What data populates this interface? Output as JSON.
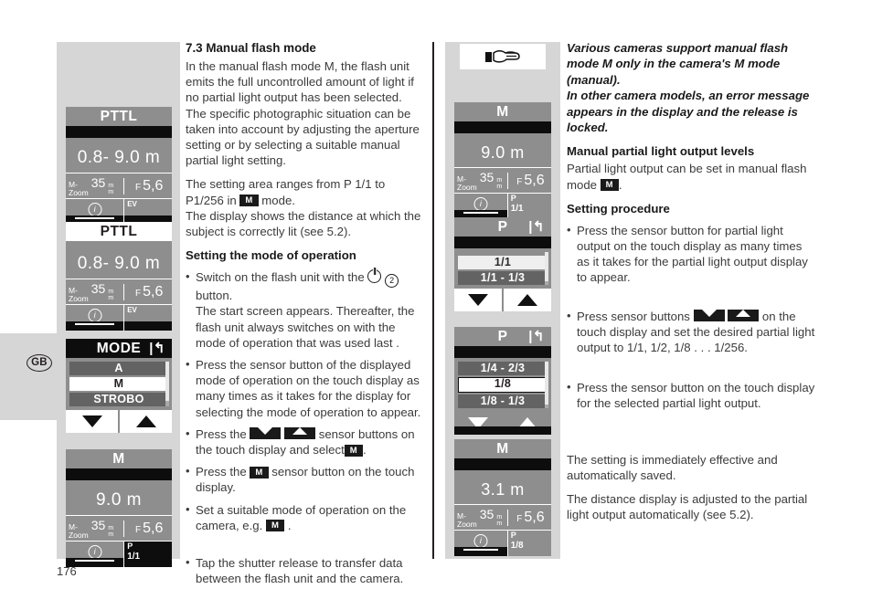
{
  "page": {
    "number": "176",
    "language_badge": "GB"
  },
  "left_column": {
    "panels": [
      {
        "name": "pttl-start-screen",
        "title": "PTTL",
        "title_style": "grey",
        "distance": "0.8- 9.0 m",
        "zoom_label_line1": "M-",
        "zoom_label_line2": "Zoom",
        "zoom_value": "35",
        "unit_line1": "m",
        "unit_line2": "m",
        "f_char": "F",
        "f_value": "5,6",
        "right_label": "EV",
        "info_icon": "info-icon"
      },
      {
        "name": "pttl-selected-screen",
        "title": "PTTL",
        "title_style": "white",
        "distance": "0.8- 9.0 m",
        "zoom_label_line1": "M-",
        "zoom_label_line2": "Zoom",
        "zoom_value": "35",
        "unit_line1": "m",
        "unit_line2": "m",
        "f_char": "F",
        "f_value": "5,6",
        "right_label": "EV",
        "info_icon": "info-icon"
      },
      {
        "name": "mode-picker",
        "title": "MODE",
        "back_icon": "back-arrow-icon",
        "items": [
          {
            "label": "A",
            "state": "dim"
          },
          {
            "label": "M",
            "state": "selected"
          },
          {
            "label": "STROBO",
            "state": "dim"
          }
        ],
        "arrow_down": "down-arrow-icon",
        "arrow_up": "up-arrow-icon"
      },
      {
        "name": "m-mode-screen",
        "title": "M",
        "title_style": "grey",
        "distance": "9.0 m",
        "zoom_label_line1": "M-",
        "zoom_label_line2": "Zoom",
        "zoom_value": "35",
        "unit_line1": "m",
        "unit_line2": "m",
        "f_char": "F",
        "f_value": "5,6",
        "right_label": "P",
        "right_value": "1/1",
        "info_icon": "info-icon"
      }
    ]
  },
  "mid_column": {
    "heading": "7.3 Manual flash mode",
    "para1": "In the manual flash mode M, the flash unit emits the full uncontrolled amount of light if no partial light output has been selected. The specific photographic situation can be taken into account by adjusting the aperture setting or by selecting a suitable manual partial light setting.",
    "para2_a": "The setting area ranges from P 1/1 to P1/256 in",
    "para2_badge": "M",
    "para2_b": "mode.",
    "para3": "The display shows the distance at which the subject is correctly lit (see 5.2).",
    "subheading": "Setting the mode of operation",
    "bullets": [
      {
        "text_a": "Switch on the flash unit with the",
        "icon": "power-icon",
        "circle_num": "2",
        "text_b": "button.",
        "sub": "The start screen appears. Thereafter, the flash unit always switches on with the mode of operation that was used last ."
      },
      {
        "text_a": "Press the sensor button of the displayed mode of operation on the touch display as many times as it takes for the display for selecting the mode of operation to appear."
      },
      {
        "text_a": "Press the",
        "badge_down": "down-arrow-badge",
        "badge_up": "up-arrow-badge",
        "text_b": "sensor buttons on the touch display and select",
        "badge_m": "M",
        "text_c": "."
      },
      {
        "text_a": "Press the",
        "badge_m": "M",
        "text_b": "sensor button on the touch display."
      },
      {
        "text_a": "Set a suitable mode of operation on the camera, e.g.",
        "badge_m": "M",
        "text_b": "."
      },
      {
        "text_a": "Tap the shutter release to transfer data between the flash unit and the camera."
      }
    ]
  },
  "right_illustration": {
    "hand_icon": "pointing-hand-icon",
    "panels": [
      {
        "name": "m-mode-screen-full",
        "title": "M",
        "distance": "9.0 m",
        "zoom_label_line1": "M-",
        "zoom_label_line2": "Zoom",
        "zoom_value": "35",
        "unit_line1": "m",
        "unit_line2": "m",
        "f_char": "F",
        "f_value": "5,6",
        "right_label": "P",
        "right_value": "1/1",
        "info_icon": "info-icon"
      },
      {
        "name": "partial-output-picker-1",
        "title": "P",
        "back_icon": "back-arrow-icon",
        "items": [
          {
            "label": "",
            "state": "blank"
          },
          {
            "label": "1/1",
            "state": "pale"
          },
          {
            "label": "1/1 - 1/3",
            "state": "dim"
          }
        ],
        "arrow_down": "down-arrow-icon",
        "arrow_up": "up-arrow-icon"
      },
      {
        "name": "partial-output-picker-2",
        "title": "P",
        "back_icon": "back-arrow-icon",
        "items": [
          {
            "label": "1/4 - 2/3",
            "state": "dim"
          },
          {
            "label": "1/8",
            "state": "selbox"
          },
          {
            "label": "1/8 - 1/3",
            "state": "dim"
          }
        ],
        "arrow_down": "down-arrow-icon",
        "arrow_up": "up-arrow-icon",
        "inverted": true
      },
      {
        "name": "m-mode-screen-partial",
        "title": "M",
        "distance": "3.1 m",
        "zoom_label_line1": "M-",
        "zoom_label_line2": "Zoom",
        "zoom_value": "35",
        "unit_line1": "m",
        "unit_line2": "m",
        "f_char": "F",
        "f_value": "5,6",
        "right_label": "P",
        "right_value": "1/8",
        "info_icon": "info-icon"
      }
    ]
  },
  "right_column": {
    "note_italic": "Various cameras support manual flash mode M only in the camera's M mode (manual).\nIn other camera models, an error message appears in the display and the release is locked.",
    "subheading1": "Manual partial light output levels",
    "para1_a": "Partial light output can be set in manual flash mode",
    "para1_badge": "M",
    "para1_b": ".",
    "subheading2": "Setting procedure",
    "bullets": [
      {
        "text_a": "Press the sensor button for partial light output on the touch display as many times as it takes for the partial light output display to appear."
      },
      {
        "text_a": "Press sensor buttons",
        "badge_down": "down-arrow-badge",
        "badge_up": "up-arrow-badge",
        "text_b": "on the touch display and set the desired partial light output to 1/1, 1/2, 1/8 . . . 1/256."
      },
      {
        "text_a": "Press the sensor button on the touch display for the selected partial light output."
      }
    ],
    "closing1": "The setting is immediately effective and automatically saved.",
    "closing2": "The distance display is adjusted to the partial light output automatically (see 5.2)."
  }
}
